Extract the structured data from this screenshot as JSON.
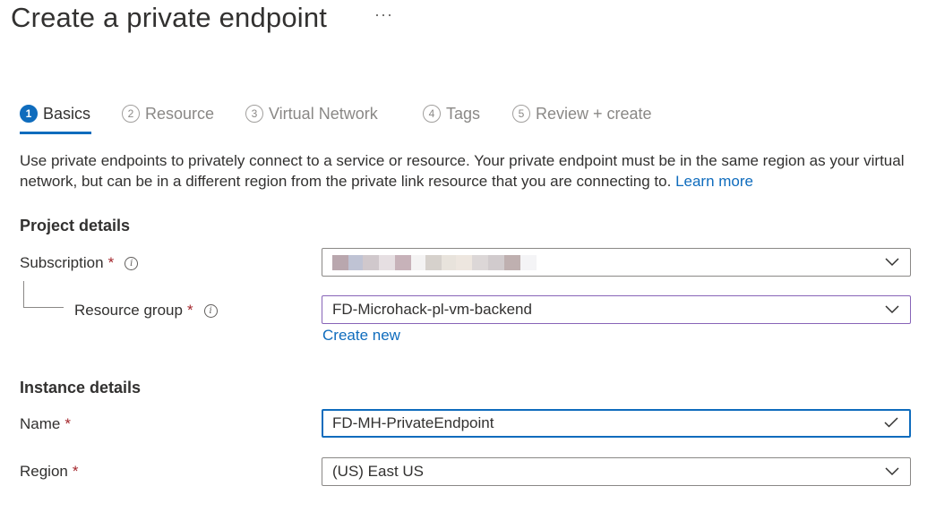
{
  "header": {
    "title": "Create a private endpoint",
    "more_label": "···"
  },
  "tabs": [
    {
      "num": "1",
      "label": "Basics"
    },
    {
      "num": "2",
      "label": "Resource"
    },
    {
      "num": "3",
      "label": "Virtual Network"
    },
    {
      "num": "4",
      "label": "Tags"
    },
    {
      "num": "5",
      "label": "Review + create"
    }
  ],
  "description": {
    "text": "Use private endpoints to privately connect to a service or resource. Your private endpoint must be in the same region as your virtual network, but can be in a different region from the private link resource that you are connecting to.",
    "learn_more": "Learn more"
  },
  "project_details": {
    "heading": "Project details",
    "subscription_label": "Subscription",
    "resource_group_label": "Resource group",
    "resource_group_value": "FD-Microhack-pl-vm-backend",
    "create_new": "Create new"
  },
  "instance_details": {
    "heading": "Instance details",
    "name_label": "Name",
    "name_value": "FD-MH-PrivateEndpoint",
    "region_label": "Region",
    "region_value": "(US) East US"
  },
  "required_marker": "*",
  "colors": {
    "accent": "#0f6cbd",
    "required": "#a4262c",
    "focus_purple": "#8764b8"
  },
  "icons": {
    "dropdown": "chevron-down-icon",
    "valid": "checkmark-icon",
    "info": "info-icon"
  }
}
